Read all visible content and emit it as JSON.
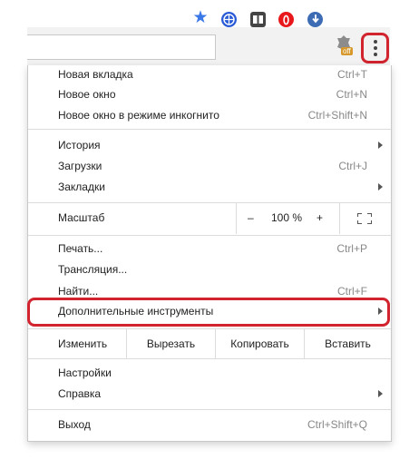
{
  "toolbar": {
    "icons": [
      "star-icon",
      "globe-icon",
      "tabs-icon",
      "opera-icon",
      "download-icon",
      "extension-off-icon",
      "more-menu-icon"
    ],
    "ext_badge": "off",
    "accent_star": "#3b78e7",
    "highlight": "#d1242f"
  },
  "menu": {
    "new_tab": {
      "label": "Новая вкладка",
      "shortcut": "Ctrl+T"
    },
    "new_window": {
      "label": "Новое окно",
      "shortcut": "Ctrl+N"
    },
    "incognito": {
      "label": "Новое окно в режиме инкогнито",
      "shortcut": "Ctrl+Shift+N"
    },
    "history": {
      "label": "История"
    },
    "downloads": {
      "label": "Загрузки",
      "shortcut": "Ctrl+J"
    },
    "bookmarks": {
      "label": "Закладки"
    },
    "zoom": {
      "label": "Масштаб",
      "minus": "–",
      "value": "100 %",
      "plus": "+"
    },
    "print": {
      "label": "Печать...",
      "shortcut": "Ctrl+P"
    },
    "cast": {
      "label": "Трансляция..."
    },
    "find": {
      "label": "Найти...",
      "shortcut": "Ctrl+F"
    },
    "more_tools": {
      "label": "Дополнительные инструменты"
    },
    "edit": {
      "label": "Изменить",
      "cut": "Вырезать",
      "copy": "Копировать",
      "paste": "Вставить"
    },
    "settings": {
      "label": "Настройки"
    },
    "help": {
      "label": "Справка"
    },
    "exit": {
      "label": "Выход",
      "shortcut": "Ctrl+Shift+Q"
    }
  }
}
